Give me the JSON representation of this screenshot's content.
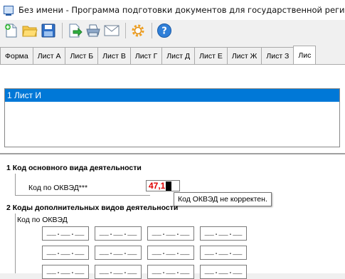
{
  "window": {
    "title": "Без имени - Программа подготовки документов для государственной регистра"
  },
  "toolbar": {
    "buttons": [
      {
        "icon": "new-document-icon"
      },
      {
        "icon": "open-folder-icon"
      },
      {
        "icon": "save-icon"
      },
      {
        "icon": "export-icon"
      },
      {
        "icon": "print-icon"
      },
      {
        "icon": "mail-icon"
      },
      {
        "icon": "settings-icon"
      },
      {
        "icon": "help-icon"
      }
    ]
  },
  "tabs": [
    "Форма",
    "Лист А",
    "Лист Б",
    "Лист В",
    "Лист Г",
    "Лист Д",
    "Лист Е",
    "Лист Ж",
    "Лист З",
    "Лис"
  ],
  "active_tab": "Лис",
  "sheet_list": {
    "items": [
      "1 Лист И"
    ],
    "selected_index": 0
  },
  "section1": {
    "title": "1  Код основного вида деятельности",
    "okved_label": "Код по ОКВЭД***",
    "okved_value": "47,1",
    "tooltip": "Код ОКВЭД не корректен."
  },
  "section2": {
    "title": "2  Коды дополнительных видов деятельности",
    "okved_label": "Код по ОКВЭД",
    "fields": [
      "__.__.__",
      "__.__.__",
      "__.__.__",
      "__.__.__",
      "__.__.__",
      "__.__.__",
      "__.__.__",
      "__.__.__",
      "__.__.__",
      "__.__.__",
      "__.__.__",
      "__.__.__"
    ]
  },
  "colors": {
    "selection": "#0078d7",
    "error_text": "#e00000"
  }
}
